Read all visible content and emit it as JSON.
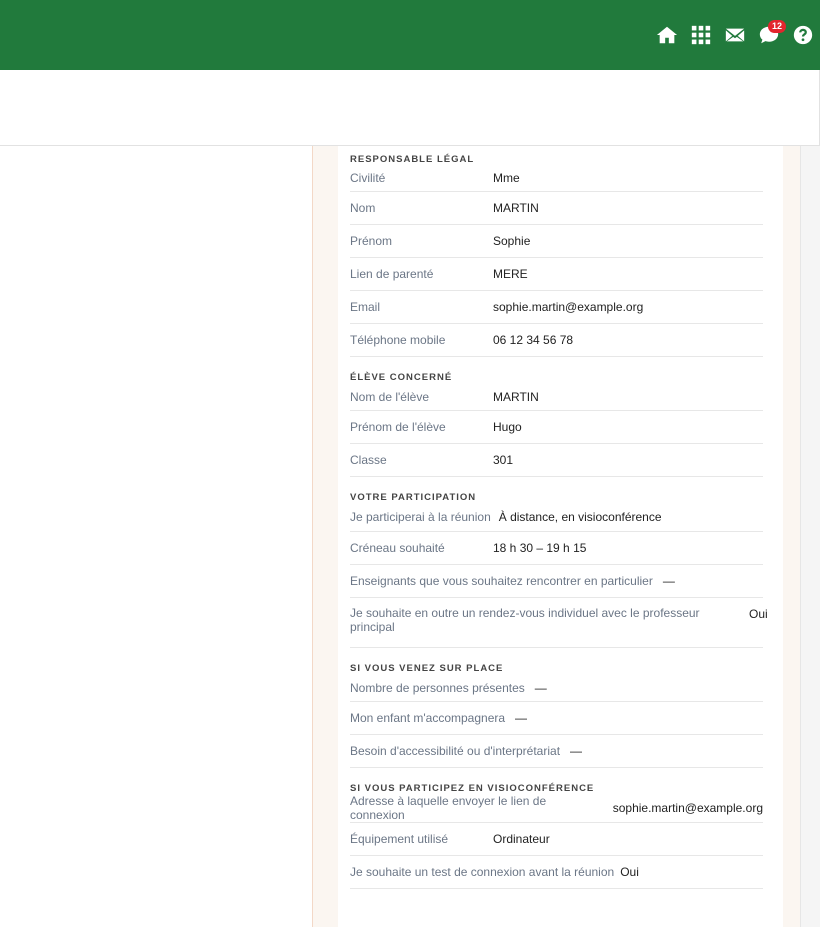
{
  "header": {
    "icons": [
      "home-icon",
      "apps-grid-icon",
      "mail-icon",
      "chat-icon",
      "help-icon"
    ],
    "notification_count": "12",
    "colors": {
      "bar": "#217a3c",
      "badge": "#e3262e"
    }
  },
  "form": {
    "responsable": {
      "title": "RESPONSABLE LÉGAL",
      "rows": [
        {
          "label": "Civilité",
          "value": "Mme"
        },
        {
          "label": "Nom",
          "value": "MARTIN"
        },
        {
          "label": "Prénom",
          "value": "Sophie"
        },
        {
          "label": "Lien de parenté",
          "value": "MERE"
        },
        {
          "label": "Email",
          "value": "sophie.martin@example.org"
        },
        {
          "label": "Téléphone mobile",
          "value": "06 12 34 56 78"
        }
      ]
    },
    "eleve": {
      "title": "ÉLÈVE CONCERNÉ",
      "rows": [
        {
          "label": "Nom de l'élève",
          "value": "MARTIN"
        },
        {
          "label": "Prénom de l'élève",
          "value": "Hugo"
        },
        {
          "label": "Classe",
          "value": "301"
        }
      ]
    },
    "participation": {
      "title": "VOTRE PARTICIPATION",
      "rows": [
        {
          "label": "Je participerai à la réunion",
          "value": "À distance, en visioconférence"
        },
        {
          "label": "Créneau souhaité",
          "value": "18 h 30 – 19 h 15"
        },
        {
          "label": "Enseignants que vous souhaitez rencontrer en particulier",
          "value": "—"
        },
        {
          "label": "Je souhaite en outre un rendez-vous individuel avec le professeur principal",
          "value": "Oui"
        }
      ]
    },
    "sur_place": {
      "title": "SI VOUS VENEZ SUR PLACE",
      "rows": [
        {
          "label": "Nombre de personnes présentes",
          "value": "—"
        },
        {
          "label": "Mon enfant m'accompagnera",
          "value": "—"
        },
        {
          "label": "Besoin d'accessibilité ou d'interprétariat",
          "value": "—"
        }
      ]
    },
    "visio": {
      "title": "SI VOUS PARTICIPEZ EN VISIOCONFÉRENCE",
      "rows": [
        {
          "label": "Adresse à laquelle envoyer le lien de connexion",
          "value": "sophie.martin@example.org"
        },
        {
          "label": "Équipement utilisé",
          "value": "Ordinateur"
        },
        {
          "label": "Je souhaite un test de connexion avant la réunion",
          "value": "Oui"
        }
      ]
    }
  }
}
